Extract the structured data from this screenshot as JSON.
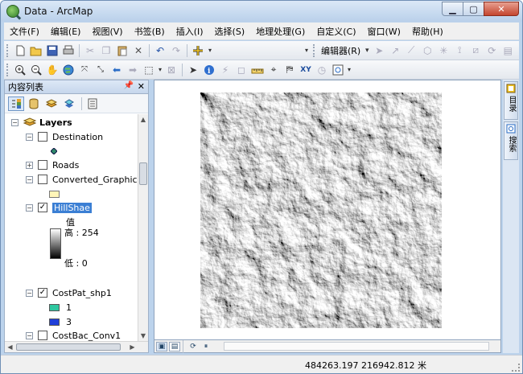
{
  "window": {
    "title": "Data - ArcMap"
  },
  "menu": [
    "文件(F)",
    "编辑(E)",
    "视图(V)",
    "书签(B)",
    "插入(I)",
    "选择(S)",
    "地理处理(G)",
    "自定义(C)",
    "窗口(W)",
    "帮助(H)"
  ],
  "toolbar": {
    "editor_label": "编辑器(R)",
    "editor_arrow": "▾"
  },
  "toc": {
    "title": "内容列表",
    "root_label": "Layers",
    "layers": [
      {
        "name": "Destination",
        "checked": false
      },
      {
        "name": "Roads",
        "checked": false
      },
      {
        "name": "Converted_Graphics",
        "checked": false
      },
      {
        "name": "HillShae",
        "checked": true
      },
      {
        "name": "CostPat_shp1",
        "checked": true
      },
      {
        "name": "CostBac_Conv1",
        "checked": false
      }
    ],
    "hillshade_legend": {
      "heading": "值",
      "high": "高 : 254",
      "low": "低 : 0"
    },
    "costpath_legend": [
      {
        "label": "1",
        "color": "#2ec7a0"
      },
      {
        "label": "3",
        "color": "#1f3fd9"
      }
    ],
    "graphic_color": "#fff5b8",
    "point_color": "#2f8a6a"
  },
  "right_dock": [
    {
      "label": "目录",
      "icon": "catalog-icon"
    },
    {
      "label": "搜索",
      "icon": "search-window-icon"
    }
  ],
  "status": {
    "coordinates": "484263.197  216942.812 米"
  },
  "colors": {
    "selection": "#3b7fd4",
    "panel_header": "#c6d6ec"
  }
}
